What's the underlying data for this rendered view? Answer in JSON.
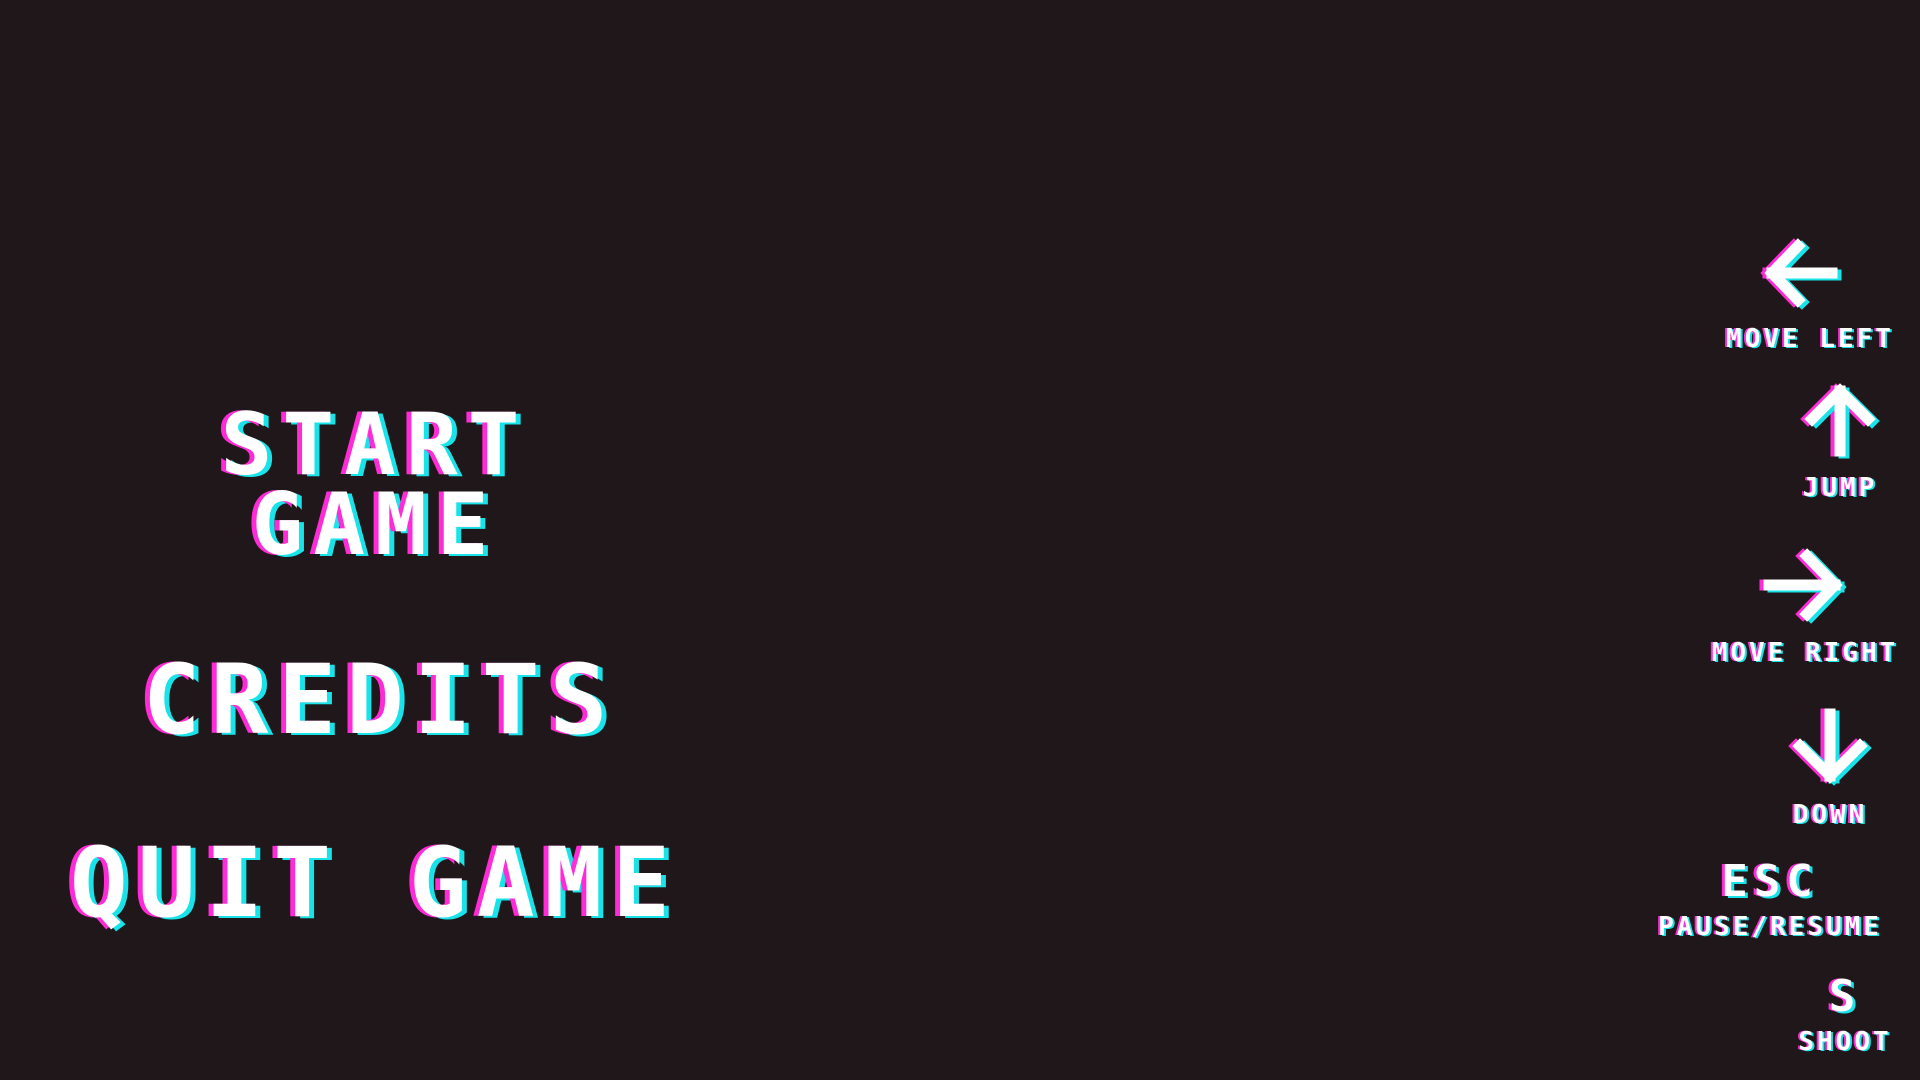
{
  "menu": {
    "start_line1": "START",
    "start_line2": "GAME",
    "credits": "CREDITS",
    "quit": "QUIT GAME"
  },
  "controls": {
    "move_left": {
      "icon": "arrow-left-icon",
      "label": "MOVE LEFT"
    },
    "jump": {
      "icon": "arrow-up-icon",
      "label": "JUMP"
    },
    "move_right": {
      "icon": "arrow-right-icon",
      "label": "MOVE RIGHT"
    },
    "down": {
      "icon": "arrow-down-icon",
      "label": "DOWN"
    },
    "pause": {
      "key": "ESC",
      "label": "PAUSE/RESUME"
    },
    "shoot": {
      "key": "S",
      "label": "SHOOT"
    }
  },
  "colors": {
    "background": "#1f1719",
    "text": "#ffffff",
    "glitch_magenta": "#ff2bd6",
    "glitch_cyan": "#18e3e8"
  }
}
